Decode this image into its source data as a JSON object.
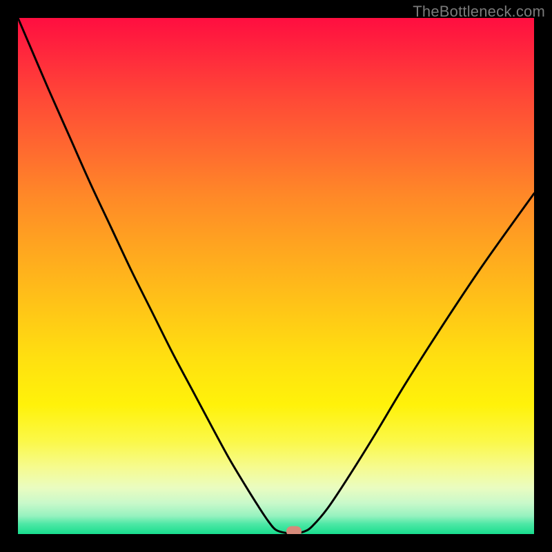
{
  "watermark": "TheBottleneck.com",
  "chart_data": {
    "type": "line",
    "title": "",
    "xlabel": "",
    "ylabel": "",
    "xlim": [
      0,
      100
    ],
    "ylim": [
      0,
      100
    ],
    "x": [
      0,
      3,
      6,
      10,
      14,
      18,
      22,
      26,
      30,
      34,
      38,
      41,
      44,
      46.5,
      48.5,
      50,
      52,
      54,
      55.5,
      57,
      60,
      64,
      69,
      75,
      82,
      90,
      100
    ],
    "y": [
      100,
      93,
      86,
      77,
      68,
      59.5,
      51,
      43,
      35,
      27.5,
      20,
      14.5,
      9.5,
      5.5,
      2.5,
      0.8,
      0.2,
      0.2,
      0.5,
      1.5,
      5,
      11,
      19,
      29,
      40,
      52,
      66
    ],
    "marker": {
      "x": 53.5,
      "y": 0.5,
      "color": "#d68a7a"
    },
    "gradient_stops": [
      {
        "pos": 0,
        "color": "#ff0e40"
      },
      {
        "pos": 50,
        "color": "#ffc218"
      },
      {
        "pos": 80,
        "color": "#fff20a"
      },
      {
        "pos": 100,
        "color": "#18dd8e"
      }
    ]
  }
}
